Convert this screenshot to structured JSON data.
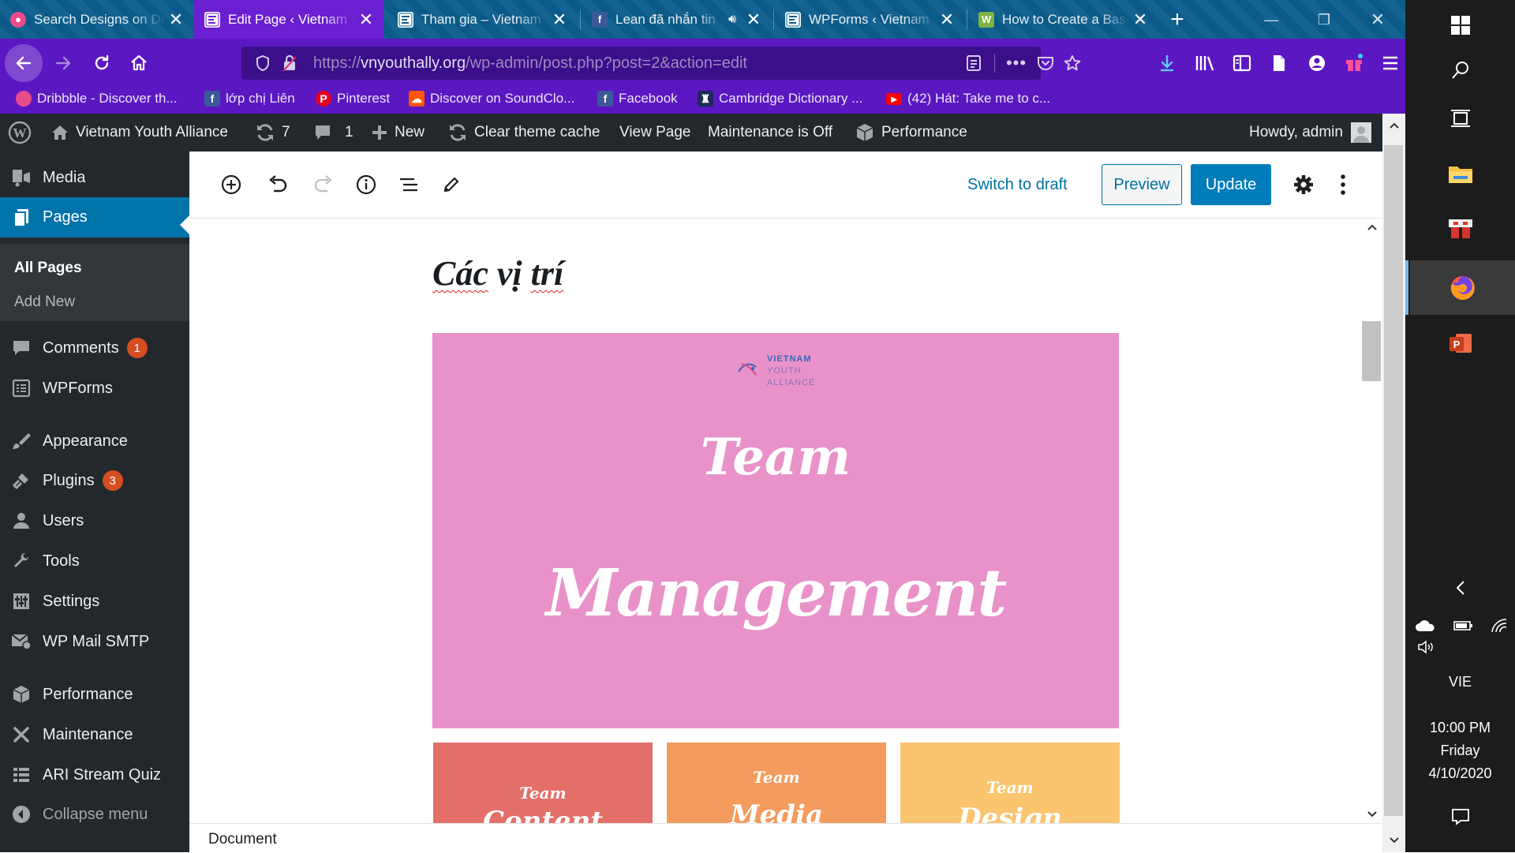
{
  "browser": {
    "tabs": [
      {
        "title": "Search Designs on Dribbble",
        "icon": "dribbble-icon",
        "active": false
      },
      {
        "title": "Edit Page ‹ Vietnam Youth Alliance",
        "icon": "wordpress-page-icon",
        "active": true
      },
      {
        "title": "Tham gia – Vietnam Youth Alliance",
        "icon": "wordpress-page-icon",
        "active": false
      },
      {
        "title": "Lean đã nhắn tin",
        "icon": "facebook-icon",
        "active": false,
        "audio": true
      },
      {
        "title": "WPForms ‹ Vietnam Youth Alliance",
        "icon": "wordpress-page-icon",
        "active": false
      },
      {
        "title": "How to Create a Basic",
        "icon": "w-icon",
        "active": false
      }
    ],
    "url": {
      "scheme": "https://",
      "domain": "vnyouthally.org",
      "path": "/wp-admin/post.php?post=2&action=edit"
    },
    "bookmarks": [
      {
        "label": "Dribbble - Discover th...",
        "icon": "dribbble-icon",
        "color": "#ea4c89"
      },
      {
        "label": "lớp chị Liên",
        "icon": "facebook-icon",
        "color": "#3b5998"
      },
      {
        "label": "Pinterest",
        "icon": "pinterest-icon",
        "color": "#e60023"
      },
      {
        "label": "Discover on SoundClo...",
        "icon": "soundcloud-icon",
        "color": "#ff5500"
      },
      {
        "label": "Facebook",
        "icon": "facebook-icon",
        "color": "#3b5998"
      },
      {
        "label": "Cambridge Dictionary ...",
        "icon": "cambridge-icon",
        "color": "#1d2a57"
      },
      {
        "label": "(42) Hát: Take me to c...",
        "icon": "youtube-icon",
        "color": "#ff0000"
      }
    ]
  },
  "adminbar": {
    "site_name": "Vietnam Youth Alliance",
    "updates_count": "7",
    "comments_count": "1",
    "new_label": "New",
    "clear_cache_label": "Clear theme cache",
    "view_page_label": "View Page",
    "maintenance_label": "Maintenance is Off",
    "performance_label": "Performance",
    "howdy": "Howdy, admin"
  },
  "sidebar": {
    "items": [
      {
        "label": "Media",
        "icon": "media-icon"
      },
      {
        "label": "Pages",
        "icon": "pages-icon",
        "current": true
      },
      {
        "label": "Comments",
        "icon": "comments-icon",
        "badge": "1"
      },
      {
        "label": "WPForms",
        "icon": "wpforms-icon"
      },
      {
        "label": "Appearance",
        "icon": "appearance-icon"
      },
      {
        "label": "Plugins",
        "icon": "plugins-icon",
        "badge": "3"
      },
      {
        "label": "Users",
        "icon": "users-icon"
      },
      {
        "label": "Tools",
        "icon": "tools-icon"
      },
      {
        "label": "Settings",
        "icon": "settings-icon"
      },
      {
        "label": "WP Mail SMTP",
        "icon": "mail-icon"
      },
      {
        "label": "Performance",
        "icon": "performance-icon"
      },
      {
        "label": "Maintenance",
        "icon": "maintenance-icon"
      },
      {
        "label": "ARI Stream Quiz",
        "icon": "quiz-icon"
      },
      {
        "label": "Collapse menu",
        "icon": "collapse-icon"
      }
    ],
    "submenu": [
      {
        "label": "All Pages",
        "current": true
      },
      {
        "label": "Add New"
      }
    ]
  },
  "editor": {
    "switch_to_draft": "Switch to draft",
    "preview": "Preview",
    "update": "Update",
    "page_title_words": [
      "Các",
      "vị",
      "trí"
    ],
    "hero": {
      "logo_lines": [
        "VIETNAM",
        "YOUTH",
        "ALLIANCE"
      ],
      "line1": "Team",
      "line2": "Management",
      "color": "#e892c9"
    },
    "tiles": [
      {
        "line1": "Team",
        "line2": "Content",
        "color": "#e36f69"
      },
      {
        "line1": "Team",
        "line2": "Media",
        "color": "#f49b5e"
      },
      {
        "line1": "Team",
        "line2": "Design",
        "color": "#fbc46f"
      }
    ],
    "footer_breadcrumb": "Document"
  },
  "taskbar": {
    "language": "VIE",
    "time": "10:00 PM",
    "day": "Friday",
    "date": "4/10/2020"
  },
  "colors": {
    "tab_active": "#6a1fd0",
    "toolbar": "#5b17c2",
    "wp_dark": "#23282d",
    "wp_blue": "#0073aa",
    "update_button": "#007cba",
    "badge": "#d54e21"
  }
}
